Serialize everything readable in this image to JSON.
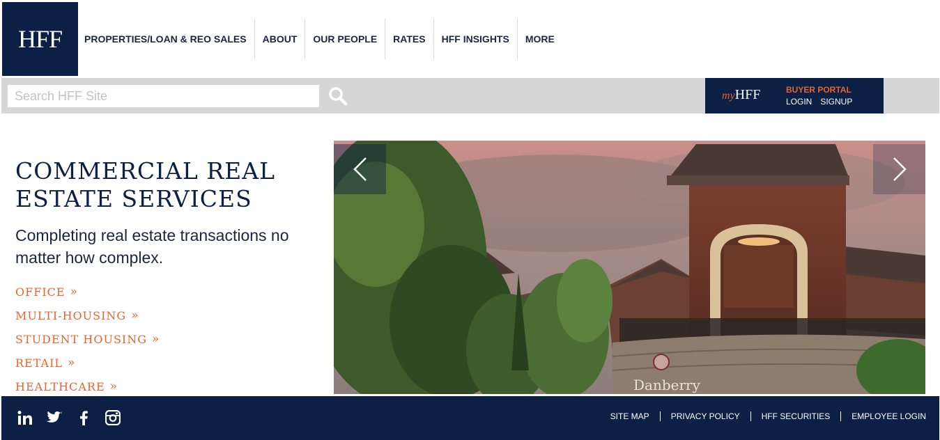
{
  "header": {
    "logo_text": "HFF",
    "nav": [
      "PROPERTIES/LOAN & REO SALES",
      "ABOUT",
      "OUR PEOPLE",
      "RATES",
      "HFF INSIGHTS",
      "MORE"
    ]
  },
  "search": {
    "placeholder": "Search HFF Site",
    "value": ""
  },
  "portal": {
    "logo_my": "my",
    "logo_hff": "HFF",
    "title": "BUYER PORTAL",
    "login": "LOGIN",
    "signup": "SIGNUP"
  },
  "hero": {
    "title": "COMMERCIAL REAL ESTATE SERVICES",
    "subtitle": "Completing real estate transactions no matter how complex.",
    "categories": [
      "OFFICE",
      "MULTI-HOUSING",
      "STUDENT HOUSING",
      "RETAIL",
      "HEALTHCARE"
    ],
    "chevron": "»"
  },
  "carousel": {
    "sign_text": "Danberry"
  },
  "footer": {
    "social_icons": [
      "linkedin-icon",
      "twitter-icon",
      "facebook-icon",
      "instagram-icon"
    ],
    "links": [
      "SITE MAP",
      "PRIVACY POLICY",
      "HFF SECURITIES",
      "EMPLOYEE LOGIN"
    ]
  },
  "colors": {
    "navy": "#0c1f45",
    "orange": "#e8642f",
    "searchbar_bg": "#d6d6d6"
  }
}
